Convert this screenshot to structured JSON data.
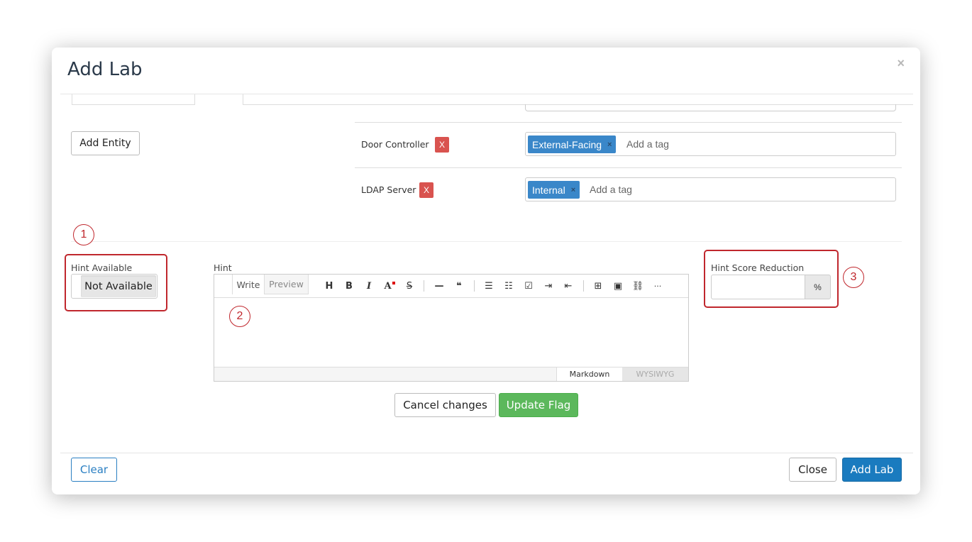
{
  "modal": {
    "title": "Add Lab",
    "close_glyph": "×"
  },
  "entities": {
    "add_button": "Add Entity",
    "delete_label": "X",
    "tag_placeholder": "Add a tag",
    "tag_remove_glyph": "×",
    "rows": [
      {
        "name": "Door Controller",
        "tag": "External-Facing"
      },
      {
        "name": "LDAP Server",
        "tag": "Internal"
      }
    ]
  },
  "hint": {
    "available_label": "Hint Available",
    "available_value": "Not Available",
    "hint_label": "Hint",
    "editor": {
      "tabs": [
        "Write",
        "Preview"
      ],
      "toolbar_icons": [
        "heading-icon",
        "bold-icon",
        "italic-icon",
        "text-color-icon",
        "strikethrough-icon",
        "horizontal-rule-icon",
        "quote-icon",
        "bullet-list-icon",
        "numbered-list-icon",
        "task-list-icon",
        "indent-icon",
        "outdent-icon",
        "table-icon",
        "image-icon",
        "link-icon",
        "more-icon"
      ],
      "toolbar_glyphs": [
        "H",
        "B",
        "I",
        "A",
        "S",
        "—",
        "❝",
        "☰",
        "☷",
        "☑",
        "⇥",
        "⇤",
        "⊞",
        "▣",
        "⛓",
        "···"
      ],
      "modes": [
        "Markdown",
        "WYSIWYG"
      ]
    },
    "score_reduction_label": "Hint Score Reduction",
    "score_reduction_value": "",
    "score_unit": "%"
  },
  "callouts": [
    "1",
    "2",
    "3"
  ],
  "colors": {
    "callout_red": "#c0272d",
    "tag_blue": "#3a87c9",
    "update_green": "#5cb85c",
    "primary_blue": "#1a7bbf",
    "danger_red": "#d9534f"
  },
  "actions": {
    "cancel": "Cancel changes",
    "update": "Update Flag",
    "clear": "Clear",
    "close": "Close",
    "add_lab": "Add Lab"
  }
}
